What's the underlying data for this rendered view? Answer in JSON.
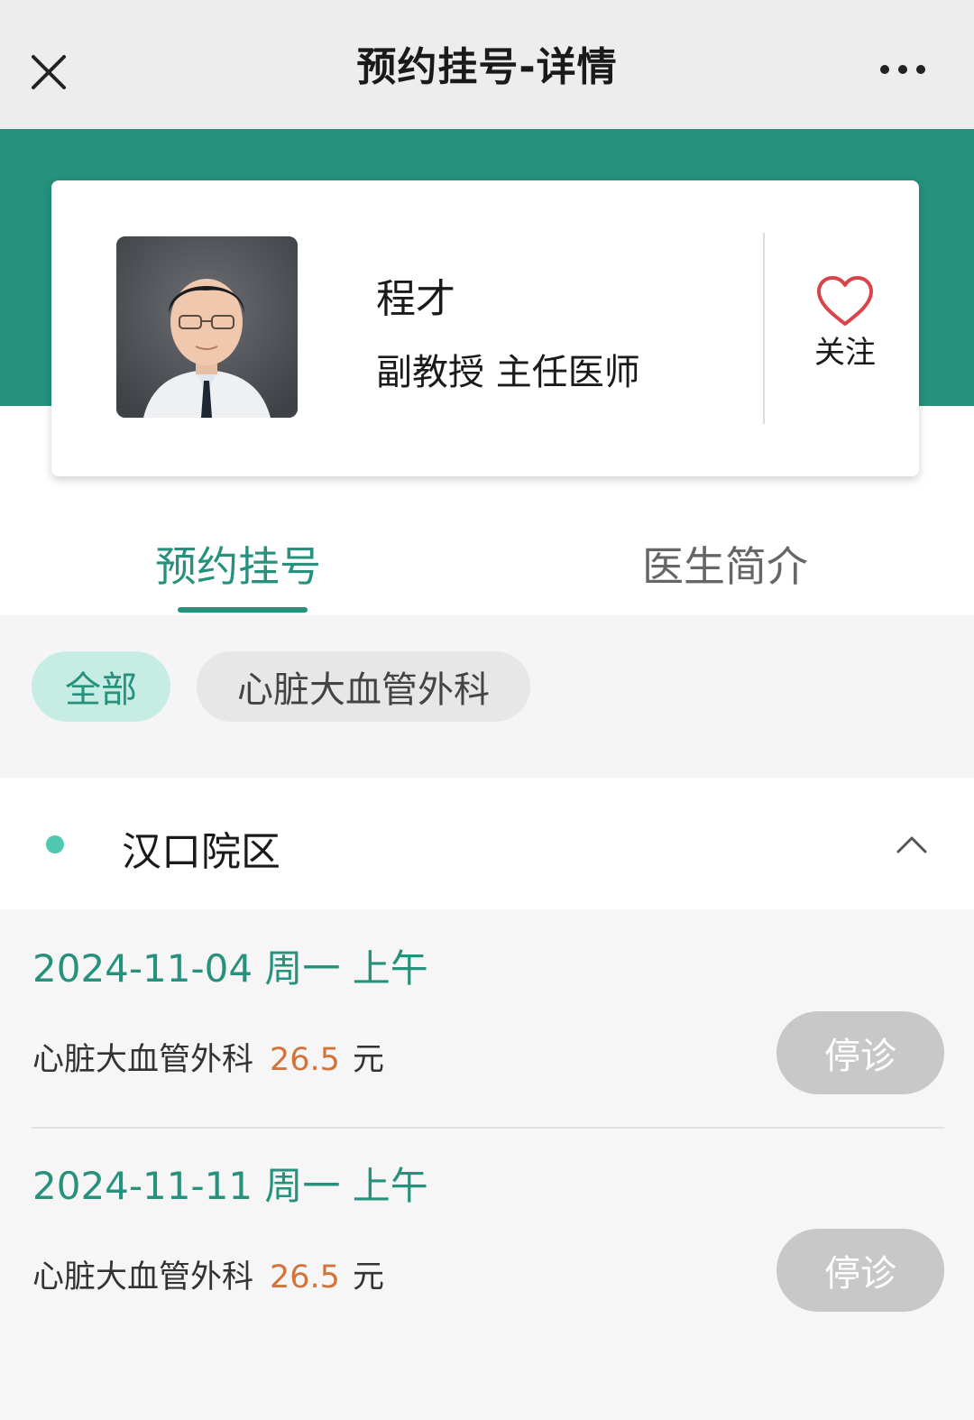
{
  "navbar": {
    "title": "预约挂号-详情",
    "close_icon": "close-icon",
    "more_icon": "more-dots-icon"
  },
  "doctor": {
    "name": "程才",
    "title": "副教授 主任医师",
    "follow_label": "关注",
    "follow_icon": "heart-outline-icon"
  },
  "tabs": [
    {
      "label": "预约挂号",
      "active": true
    },
    {
      "label": "医生简介",
      "active": false
    }
  ],
  "filters": [
    {
      "label": "全部",
      "selected": true
    },
    {
      "label": "心脏大血管外科",
      "selected": false
    }
  ],
  "campus": {
    "name": "汉口院区",
    "expanded": true
  },
  "slots": [
    {
      "date": "2024-11-04 周一 上午",
      "department": "心脏大血管外科",
      "price": "26.5",
      "unit": "元",
      "status_label": "停诊"
    },
    {
      "date": "2024-11-11 周一 上午",
      "department": "心脏大血管外科",
      "price": "26.5",
      "unit": "元",
      "status_label": "停诊"
    }
  ],
  "colors": {
    "brand_green": "#26917d",
    "chip_selected_bg": "#c6ece4",
    "price_orange": "#d2733a",
    "disabled_button": "#c8c8c8",
    "heart_red": "#d9434a"
  }
}
